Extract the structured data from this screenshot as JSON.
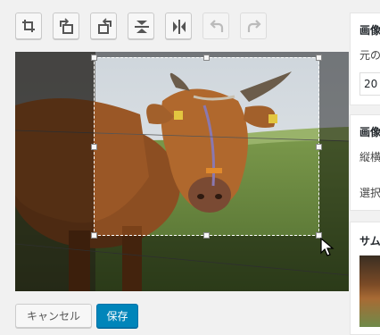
{
  "toolbar": {
    "tools": [
      {
        "name": "crop-icon",
        "enabled": true
      },
      {
        "name": "rotate-left-icon",
        "enabled": true
      },
      {
        "name": "rotate-right-icon",
        "enabled": true
      },
      {
        "name": "flip-vertical-icon",
        "enabled": true
      },
      {
        "name": "flip-horizontal-icon",
        "enabled": true
      },
      {
        "name": "undo-icon",
        "enabled": false
      },
      {
        "name": "redo-icon",
        "enabled": false
      }
    ]
  },
  "actions": {
    "cancel_label": "キャンセル",
    "save_label": "保存"
  },
  "side": {
    "scale": {
      "title": "画像",
      "text": "元の",
      "value": "20"
    },
    "crop": {
      "title": "画像",
      "ratio_label": "縦横",
      "selection_label": "選択"
    },
    "thumb": {
      "title": "サム"
    }
  },
  "colors": {
    "primary": "#0085ba",
    "background": "#f1f1f1"
  }
}
